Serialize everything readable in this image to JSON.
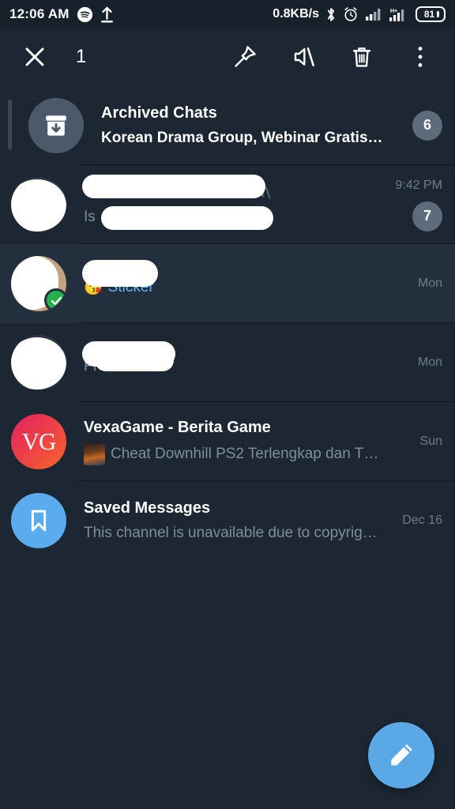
{
  "statusbar": {
    "time": "12:06 AM",
    "network_speed": "0.8KB/s",
    "battery": "81",
    "icons": [
      "spotify-icon",
      "upload-icon",
      "bluetooth-icon",
      "alarm-icon",
      "signal-icon",
      "signal-hplus-icon",
      "battery-icon"
    ]
  },
  "actionbar": {
    "close_label": "✕",
    "selected_count": "1",
    "actions": [
      "pin-icon",
      "mute-icon",
      "delete-icon",
      "overflow-menu-icon"
    ]
  },
  "archived": {
    "title": "Archived Chats",
    "preview": "Korean Drama Group, Webinar Gratis…",
    "badge": "6"
  },
  "chats": [
    {
      "name": "",
      "preview": "Is",
      "time": "9:42 PM",
      "badge": "7",
      "muted": true,
      "selected": false,
      "redacted": true,
      "avatar_type": "redacted"
    },
    {
      "name": "",
      "preview": "Sticker",
      "preview_emoji": "😘",
      "time": "Mon",
      "badge": "",
      "muted": false,
      "selected": true,
      "redacted": true,
      "avatar_type": "redacted"
    },
    {
      "name": "",
      "preview": "FF",
      "time": "Mon",
      "badge": "",
      "muted": false,
      "selected": false,
      "redacted": true,
      "avatar_type": "redacted"
    },
    {
      "name": "VexaGame - Berita Game",
      "preview": "Cheat Downhill PS2 Terlengkap dan T…",
      "time": "Sun",
      "badge": "",
      "muted": false,
      "selected": false,
      "redacted": false,
      "avatar_type": "vg",
      "avatar_text": "VG",
      "has_thumb": true
    },
    {
      "name": "Saved Messages",
      "preview": "This channel is unavailable due to copyrig…",
      "time": "Dec 16",
      "badge": "",
      "muted": false,
      "selected": false,
      "redacted": false,
      "avatar_type": "saved"
    }
  ],
  "fab": {
    "icon": "compose-pencil-icon"
  },
  "colors": {
    "background": "#1c2733",
    "appbar": "#1d2733",
    "selected_row": "#242f3d",
    "accent": "#5aa9e6",
    "link": "#5eb5f7",
    "check": "#26b14c",
    "badge": "#5d6b7a"
  }
}
